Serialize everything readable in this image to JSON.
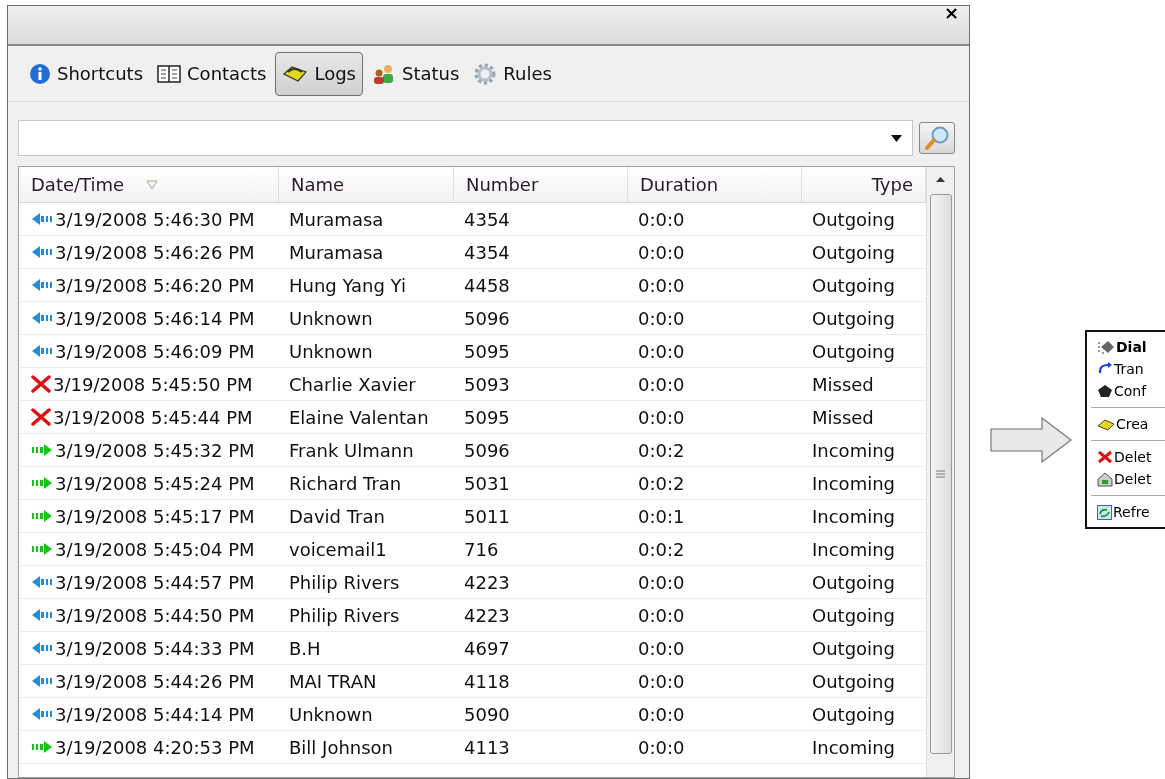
{
  "window": {
    "close": "×"
  },
  "tabs": [
    {
      "label": "Shortcuts",
      "selected": false
    },
    {
      "label": "Contacts",
      "selected": false
    },
    {
      "label": "Logs",
      "selected": true
    },
    {
      "label": "Status",
      "selected": false
    },
    {
      "label": "Rules",
      "selected": false
    }
  ],
  "table": {
    "columns": [
      "Date/Time",
      "Name",
      "Number",
      "Duration",
      "Type"
    ],
    "rows": [
      {
        "kind": "outgoing",
        "cells": [
          "3/19/2008 5:46:30 PM",
          "Muramasa",
          "4354",
          "0:0:0",
          "Outgoing"
        ]
      },
      {
        "kind": "outgoing",
        "cells": [
          "3/19/2008 5:46:26 PM",
          "Muramasa",
          "4354",
          "0:0:0",
          "Outgoing"
        ]
      },
      {
        "kind": "outgoing",
        "cells": [
          "3/19/2008 5:46:20 PM",
          "Hung Yang Yi",
          "4458",
          "0:0:0",
          "Outgoing"
        ]
      },
      {
        "kind": "outgoing",
        "cells": [
          "3/19/2008 5:46:14 PM",
          "Unknown",
          "5096",
          "0:0:0",
          "Outgoing"
        ]
      },
      {
        "kind": "outgoing",
        "cells": [
          "3/19/2008 5:46:09 PM",
          "Unknown",
          "5095",
          "0:0:0",
          "Outgoing"
        ]
      },
      {
        "kind": "missed",
        "cells": [
          "3/19/2008 5:45:50 PM",
          "Charlie Xavier",
          "5093",
          "0:0:0",
          "Missed"
        ]
      },
      {
        "kind": "missed",
        "cells": [
          "3/19/2008 5:45:44 PM",
          "Elaine Valentan",
          "5095",
          "0:0:0",
          "Missed"
        ]
      },
      {
        "kind": "incoming",
        "cells": [
          "3/19/2008 5:45:32 PM",
          "Frank Ulmann",
          "5096",
          "0:0:2",
          "Incoming"
        ]
      },
      {
        "kind": "incoming",
        "cells": [
          "3/19/2008 5:45:24 PM",
          "Richard Tran",
          "5031",
          "0:0:2",
          "Incoming"
        ]
      },
      {
        "kind": "incoming",
        "cells": [
          "3/19/2008 5:45:17 PM",
          "David Tran",
          "5011",
          "0:0:1",
          "Incoming"
        ]
      },
      {
        "kind": "incoming",
        "cells": [
          "3/19/2008 5:45:04 PM",
          "voicemail1",
          "716",
          "0:0:2",
          "Incoming"
        ]
      },
      {
        "kind": "outgoing",
        "cells": [
          "3/19/2008 5:44:57 PM",
          "Philip Rivers",
          "4223",
          "0:0:0",
          "Outgoing"
        ]
      },
      {
        "kind": "outgoing",
        "cells": [
          "3/19/2008 5:44:50 PM",
          "Philip Rivers",
          "4223",
          "0:0:0",
          "Outgoing"
        ]
      },
      {
        "kind": "outgoing",
        "cells": [
          "3/19/2008 5:44:33 PM",
          "B.H",
          "4697",
          "0:0:0",
          "Outgoing"
        ]
      },
      {
        "kind": "outgoing",
        "cells": [
          "3/19/2008 5:44:26 PM",
          "MAI TRAN",
          "4118",
          "0:0:0",
          "Outgoing"
        ]
      },
      {
        "kind": "outgoing",
        "cells": [
          "3/19/2008 5:44:14 PM",
          "Unknown",
          "5090",
          "0:0:0",
          "Outgoing"
        ]
      },
      {
        "kind": "incoming",
        "cells": [
          "3/19/2008 4:20:53 PM",
          "Bill Johnson",
          "4113",
          "0:0:0",
          "Incoming"
        ]
      }
    ]
  },
  "context_menu": {
    "groups": [
      [
        "Dial",
        "Tran",
        "Conf"
      ],
      [
        "Crea"
      ],
      [
        "Delet",
        "Delet"
      ],
      [
        "Refre"
      ]
    ]
  }
}
